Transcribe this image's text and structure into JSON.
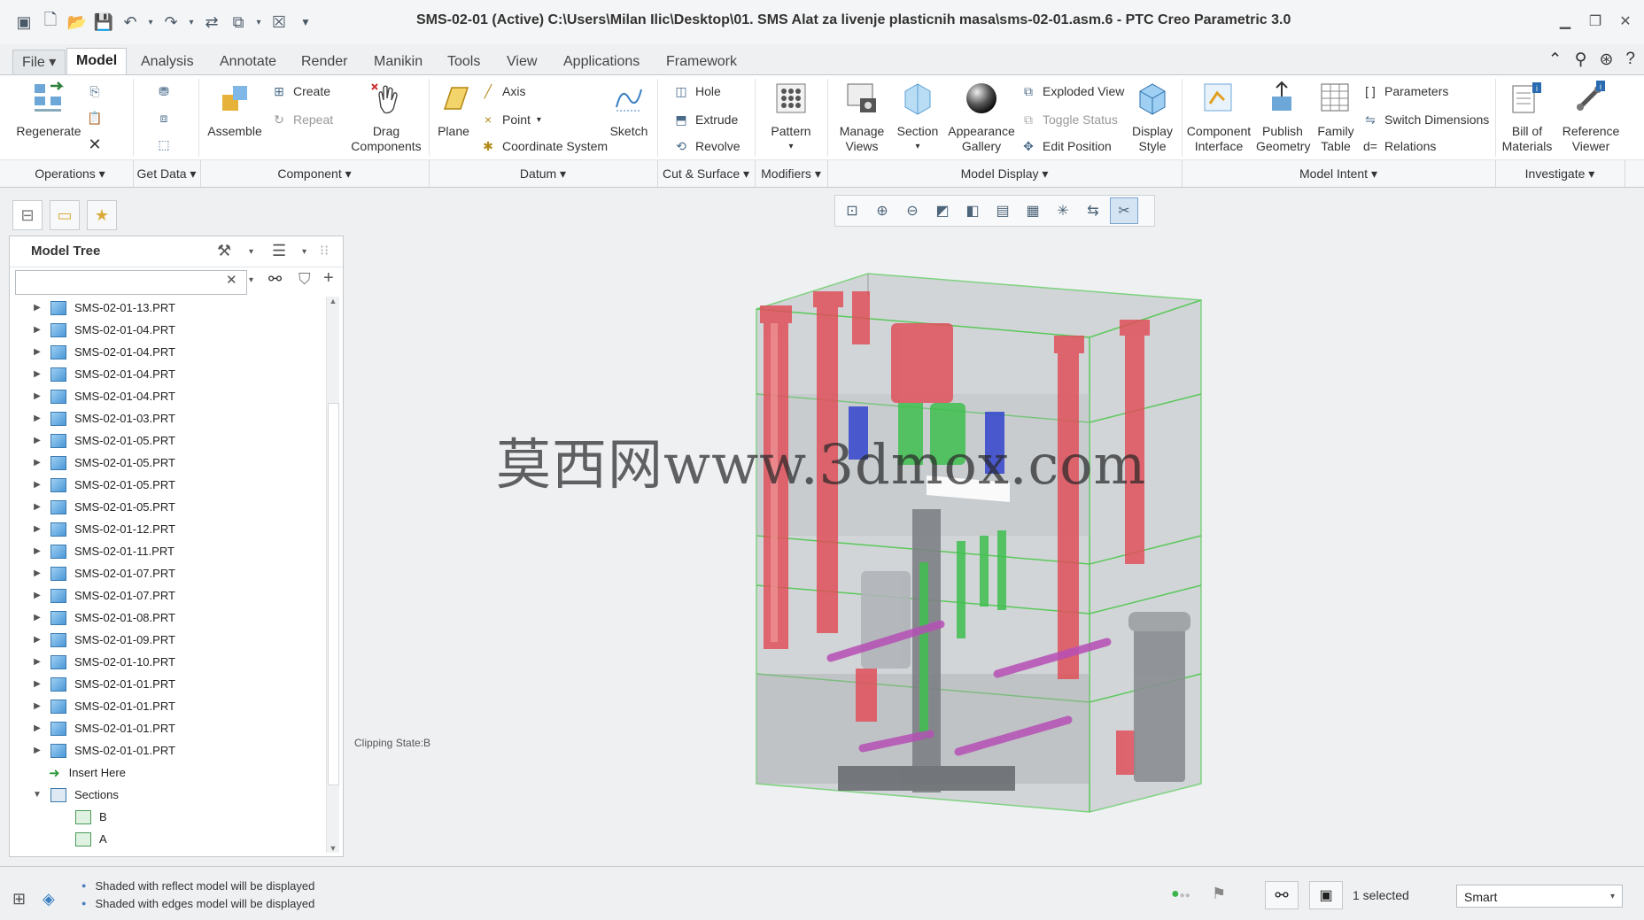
{
  "window": {
    "title": "SMS-02-01 (Active) C:\\Users\\Milan Ilic\\Desktop\\01. SMS Alat za livenje plasticnih masa\\sms-02-01.asm.6 - PTC Creo Parametric 3.0"
  },
  "quick_access": [
    "app-icon",
    "new-icon",
    "open-icon",
    "save-icon",
    "undo-icon",
    "redo-icon",
    "regenerate-icon",
    "windows-icon",
    "close-icon",
    "customize-icon"
  ],
  "tabs": [
    {
      "label": "File ▾"
    },
    {
      "label": "Model"
    },
    {
      "label": "Analysis"
    },
    {
      "label": "Annotate"
    },
    {
      "label": "Render"
    },
    {
      "label": "Manikin"
    },
    {
      "label": "Tools"
    },
    {
      "label": "View"
    },
    {
      "label": "Applications"
    },
    {
      "label": "Framework"
    }
  ],
  "active_tab": "Model",
  "ribbon": {
    "regenerate": "Regenerate",
    "assemble": "Assemble",
    "create": "Create",
    "repeat": "Repeat",
    "drag_components_1": "Drag",
    "drag_components_2": "Components",
    "plane": "Plane",
    "axis": "Axis",
    "point": "Point",
    "coordinate_system": "Coordinate System",
    "sketch": "Sketch",
    "hole": "Hole",
    "extrude": "Extrude",
    "revolve": "Revolve",
    "pattern": "Pattern",
    "manage_views_1": "Manage",
    "manage_views_2": "Views",
    "section": "Section",
    "appearance_gallery_1": "Appearance",
    "appearance_gallery_2": "Gallery",
    "exploded_view": "Exploded View",
    "toggle_status": "Toggle Status",
    "edit_position": "Edit Position",
    "display_style_1": "Display",
    "display_style_2": "Style",
    "component_interface_1": "Component",
    "component_interface_2": "Interface",
    "publish_geometry_1": "Publish",
    "publish_geometry_2": "Geometry",
    "family_table_1": "Family",
    "family_table_2": "Table",
    "parameters": "Parameters",
    "switch_dimensions": "Switch Dimensions",
    "relations": "Relations",
    "bill_of_materials_1": "Bill of",
    "bill_of_materials_2": "Materials",
    "reference_viewer_1": "Reference",
    "reference_viewer_2": "Viewer"
  },
  "groups": {
    "operations": "Operations ▾",
    "get_data": "Get Data ▾",
    "component": "Component ▾",
    "datum": "Datum ▾",
    "cut_surface": "Cut & Surface ▾",
    "modifiers": "Modifiers ▾",
    "model_display": "Model Display ▾",
    "model_intent": "Model Intent ▾",
    "investigate": "Investigate ▾"
  },
  "model_tree": {
    "title": "Model Tree",
    "search_value": "",
    "items": [
      {
        "label": "SMS-02-01-13.PRT"
      },
      {
        "label": "SMS-02-01-04.PRT"
      },
      {
        "label": "SMS-02-01-04.PRT"
      },
      {
        "label": "SMS-02-01-04.PRT"
      },
      {
        "label": "SMS-02-01-04.PRT"
      },
      {
        "label": "SMS-02-01-03.PRT"
      },
      {
        "label": "SMS-02-01-05.PRT"
      },
      {
        "label": "SMS-02-01-05.PRT"
      },
      {
        "label": "SMS-02-01-05.PRT"
      },
      {
        "label": "SMS-02-01-05.PRT"
      },
      {
        "label": "SMS-02-01-12.PRT"
      },
      {
        "label": "SMS-02-01-11.PRT"
      },
      {
        "label": "SMS-02-01-07.PRT"
      },
      {
        "label": "SMS-02-01-07.PRT"
      },
      {
        "label": "SMS-02-01-08.PRT"
      },
      {
        "label": "SMS-02-01-09.PRT"
      },
      {
        "label": "SMS-02-01-10.PRT"
      },
      {
        "label": "SMS-02-01-01.PRT"
      },
      {
        "label": "SMS-02-01-01.PRT"
      },
      {
        "label": "SMS-02-01-01.PRT"
      },
      {
        "label": "SMS-02-01-01.PRT"
      }
    ],
    "insert_here": "Insert Here",
    "sections": "Sections",
    "section_items": [
      {
        "label": "B"
      },
      {
        "label": "A"
      }
    ]
  },
  "viewport": {
    "clipping_state": "Clipping State:B",
    "watermark": "莫西网www.3dmox.com"
  },
  "status": {
    "messages": [
      "Shaded with reflect model will be displayed",
      "Shaded with edges model will be displayed"
    ],
    "selected": "1 selected",
    "filter": "Smart"
  }
}
